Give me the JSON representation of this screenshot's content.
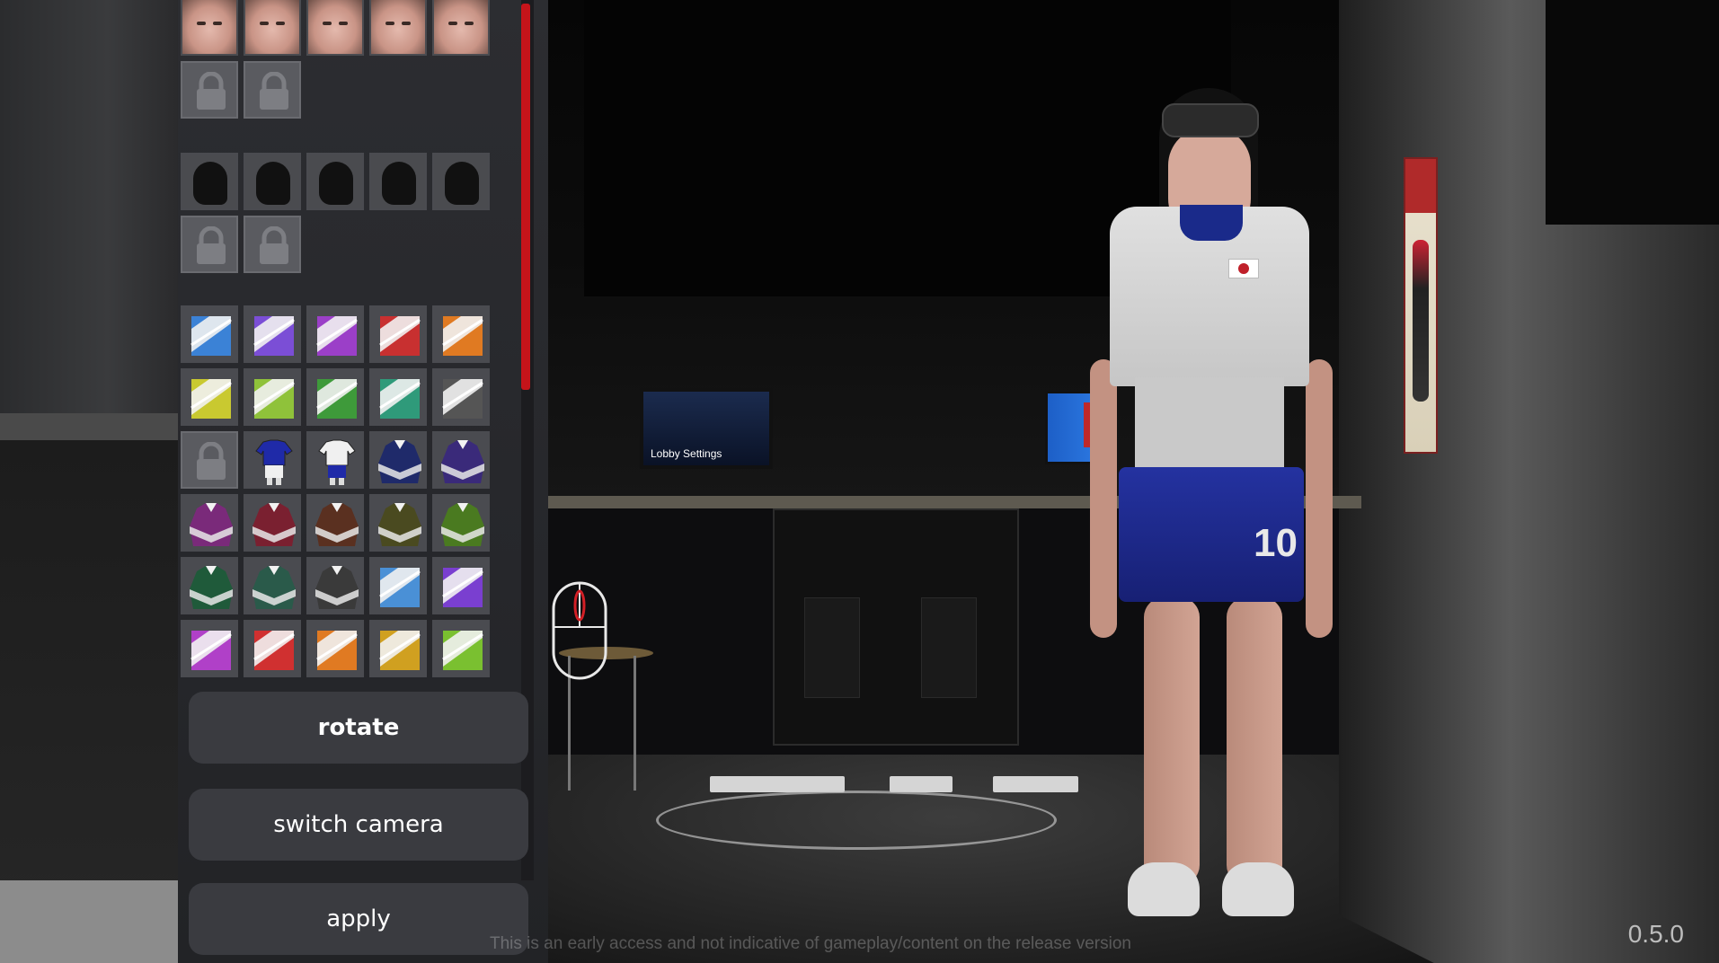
{
  "panel": {
    "face_options": {
      "unlocked": 5,
      "locked": 2
    },
    "hair_options": {
      "unlocked": 5,
      "locked": 2
    },
    "outfit_rows": [
      [
        {
          "c": "#3b82d6"
        },
        {
          "c": "#7b4ed6"
        },
        {
          "c": "#9b3fc8"
        },
        {
          "c": "#c83030"
        },
        {
          "c": "#e07a22"
        }
      ],
      [
        {
          "c": "#c9c930"
        },
        {
          "c": "#8fc23a"
        },
        {
          "c": "#3e9a3a"
        },
        {
          "c": "#2f9a7a"
        },
        {
          "c": "#555555"
        }
      ],
      [
        {
          "locked": true
        },
        {
          "c": "#1f2aa8",
          "style": "kit"
        },
        {
          "c": "#f0f0f0",
          "style": "kit"
        },
        {
          "c": "#1f2a6a",
          "style": "jacket"
        },
        {
          "c": "#3a2a7a",
          "style": "jacket"
        }
      ],
      [
        {
          "c": "#7a2a7a",
          "style": "jacket"
        },
        {
          "c": "#7a2030",
          "style": "jacket"
        },
        {
          "c": "#5a3020",
          "style": "jacket"
        },
        {
          "c": "#4a4a20",
          "style": "jacket"
        },
        {
          "c": "#4a7a20",
          "style": "jacket"
        }
      ],
      [
        {
          "c": "#1f5a3a",
          "style": "jacket"
        },
        {
          "c": "#2a5a4a",
          "style": "jacket"
        },
        {
          "c": "#3a3a3a",
          "style": "jacket"
        },
        {
          "c": "#4a90d6"
        },
        {
          "c": "#7a3fd0"
        }
      ],
      [
        {
          "c": "#b040c8"
        },
        {
          "c": "#d03030"
        },
        {
          "c": "#e07a22"
        },
        {
          "c": "#d0a020"
        },
        {
          "c": "#7ac030"
        }
      ]
    ],
    "buttons": {
      "rotate": "rotate",
      "switch_camera": "switch camera",
      "apply": "apply"
    }
  },
  "scene": {
    "monitor_label": "Lobby Settings",
    "shorts_number": "10"
  },
  "footer": {
    "notice": "This is an early access and not indicative of gameplay/content on the release version",
    "version": "0.5.0"
  },
  "colors": {
    "accent": "#c5141a",
    "button_bg": "#3a3b40",
    "panel_bg": "#2c2d31"
  },
  "icons": {
    "lock": "lock-icon",
    "mouse": "mouse-icon"
  }
}
